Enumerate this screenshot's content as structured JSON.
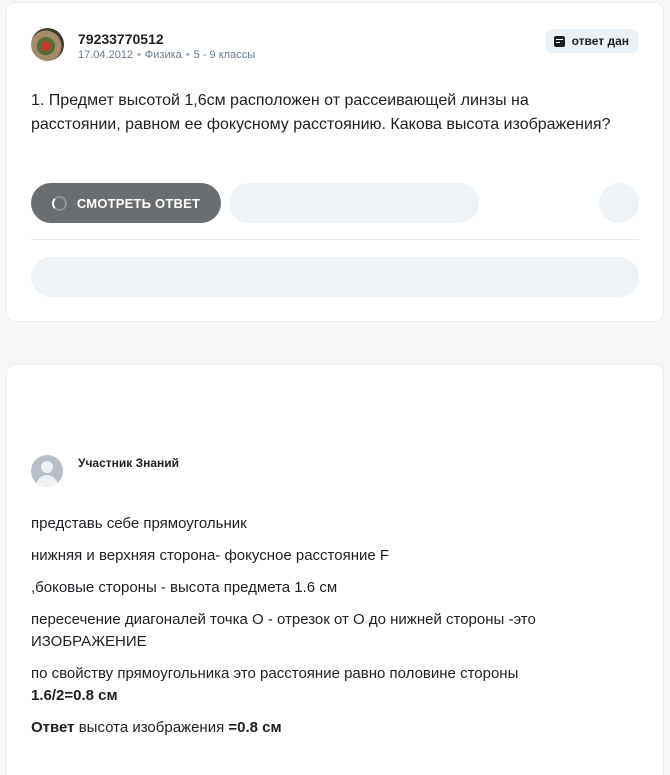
{
  "question": {
    "username": "79233770512",
    "date": "17.04.2012",
    "subject": "Физика",
    "grade": "5 - 9 классы",
    "badge": "ответ дан",
    "text": "1. Предмет высотой 1,6см расположен от рассеивающей линзы на расстоянии, равном ее фокусному расстоянию. Какова высота изображения?",
    "view_button": "СМОТРЕТЬ ОТВЕТ"
  },
  "answer": {
    "author": "Участник Знаний",
    "lines": {
      "l1": "представь себе прямоугольник",
      "l2": "нижняя и верхняя сторона- фокусное расстояние F",
      "l3": ",боковые стороны - высота предмета 1.6 см",
      "l4": "пересечение диагоналей точка О  - отрезок от О до нижней стороны -это ИЗОБРАЖЕНИЕ",
      "l5": "по свойству прямоугольника это расстояние равно половине стороны",
      "l5_bold": "1.6/2=0.8 см",
      "l6_bold": "Ответ",
      "l6": " высота изображения ",
      "l6_value": "=0.8 см"
    }
  },
  "icons": {
    "badge": "answered-icon",
    "spinner": "loading-spinner-icon",
    "avatar_default": "user-avatar-icon"
  }
}
